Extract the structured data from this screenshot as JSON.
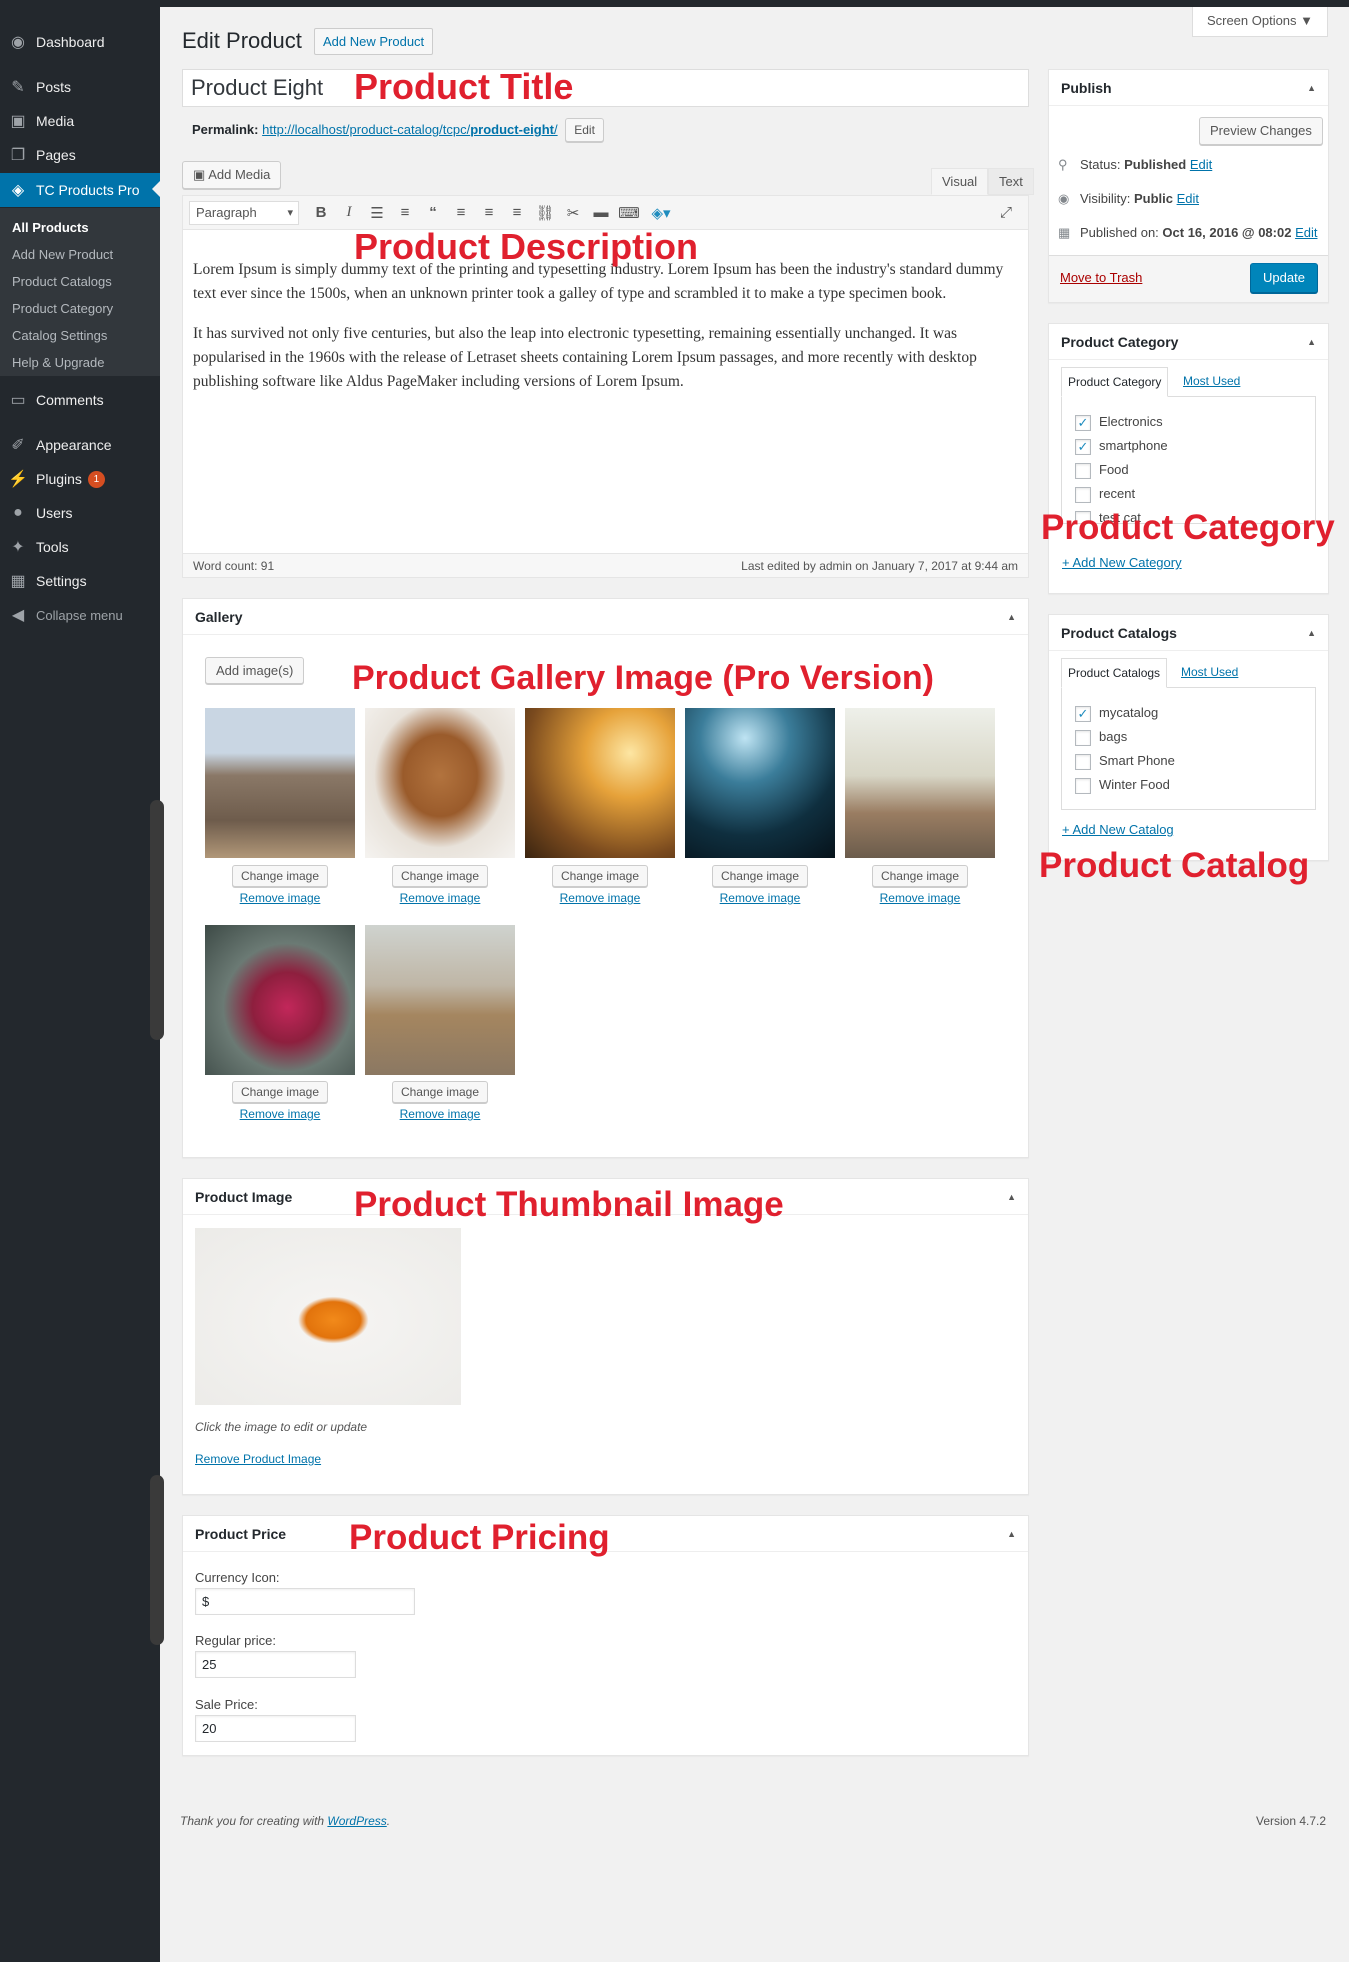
{
  "sidebar": {
    "menu": [
      {
        "label": "Dashboard",
        "icon": "dashboard-icon"
      },
      {
        "label": "Posts",
        "icon": "pin-icon"
      },
      {
        "label": "Media",
        "icon": "media-icon"
      },
      {
        "label": "Pages",
        "icon": "pages-icon"
      },
      {
        "label": "TC Products Pro",
        "icon": "dropbox-icon"
      },
      {
        "label": "Comments",
        "icon": "comment-icon"
      },
      {
        "label": "Appearance",
        "icon": "brush-icon"
      },
      {
        "label": "Plugins",
        "icon": "plugin-icon",
        "badge": "1"
      },
      {
        "label": "Users",
        "icon": "users-icon"
      },
      {
        "label": "Tools",
        "icon": "wrench-icon"
      },
      {
        "label": "Settings",
        "icon": "settings-icon"
      },
      {
        "label": "Collapse menu",
        "icon": "collapse-icon"
      }
    ],
    "submenu": [
      "All Products",
      "Add New Product",
      "Product Catalogs",
      "Product Category",
      "Catalog Settings",
      "Help & Upgrade"
    ]
  },
  "header": {
    "title": "Edit Product",
    "add_new": "Add New Product",
    "screen_options": "Screen Options"
  },
  "post": {
    "title": "Product Eight",
    "permalink_label": "Permalink:",
    "permalink_base": "http://localhost/product-catalog/tcpc/",
    "permalink_slug": "product-eight",
    "permalink_trail": "/",
    "permalink_edit": "Edit"
  },
  "editor": {
    "add_media": "Add Media",
    "tab_visual": "Visual",
    "tab_text": "Text",
    "format": "Paragraph",
    "para1": "Lorem Ipsum is simply dummy text of the printing and typesetting industry. Lorem Ipsum has been the industry's standard dummy text ever since the 1500s, when an unknown printer took a galley of type and scrambled it to make a type specimen book.",
    "para2": "It has survived not only five centuries, but also the leap into electronic typesetting, remaining essentially unchanged. It was popularised in the 1960s with the release of Letraset sheets containing Lorem Ipsum passages, and more recently with desktop publishing software like Aldus PageMaker including versions of Lorem Ipsum.",
    "word_count": "Word count: 91",
    "last_edited": "Last edited by admin on January 7, 2017 at 9:44 am"
  },
  "gallery": {
    "title": "Gallery",
    "add_images": "Add image(s)",
    "change": "Change image",
    "remove": "Remove image",
    "images": [
      "elephants",
      "pecans",
      "sunset-woman",
      "concert",
      "dancer",
      "apple",
      "guitar-girl"
    ]
  },
  "product_image": {
    "title": "Product Image",
    "hint": "Click the image to edit or update",
    "remove": "Remove Product Image"
  },
  "price": {
    "title": "Product Price",
    "currency_label": "Currency Icon:",
    "currency": "$",
    "regular_label": "Regular price:",
    "regular": "25",
    "sale_label": "Sale Price:",
    "sale": "20"
  },
  "publish": {
    "title": "Publish",
    "preview": "Preview Changes",
    "status_label": "Status:",
    "status": "Published",
    "visibility_label": "Visibility:",
    "visibility": "Public",
    "published_label": "Published on:",
    "published": "Oct 16, 2016 @ 08:02",
    "edit": "Edit",
    "trash": "Move to Trash",
    "update": "Update"
  },
  "category": {
    "title": "Product Category",
    "tab_all": "Product Category",
    "tab_used": "Most Used",
    "items": [
      {
        "label": "Electronics",
        "checked": true
      },
      {
        "label": "smartphone",
        "checked": true
      },
      {
        "label": "Food",
        "checked": false
      },
      {
        "label": "recent",
        "checked": false
      },
      {
        "label": "test cat",
        "checked": false
      }
    ],
    "add_new": "+ Add New Category"
  },
  "catalogs": {
    "title": "Product Catalogs",
    "tab_all": "Product Catalogs",
    "tab_used": "Most Used",
    "items": [
      {
        "label": "mycatalog",
        "checked": true
      },
      {
        "label": "bags",
        "checked": false
      },
      {
        "label": "Smart Phone",
        "checked": false
      },
      {
        "label": "Winter Food",
        "checked": false
      }
    ],
    "add_new": "+ Add New Catalog"
  },
  "annotations": {
    "title": "Product Title",
    "description": "Product  Description",
    "gallery": "Product Gallery Image (Pro Version)",
    "category": "Product Category",
    "catalog": "Product Catalog",
    "thumbnail": "Product Thumbnail Image",
    "pricing": "Product Pricing"
  },
  "footer": {
    "thanks_pre": "Thank you for creating with ",
    "thanks_link": "WordPress",
    "thanks_post": ".",
    "version": "Version 4.7.2"
  },
  "colors": {
    "accent": "#0073aa",
    "sidebar": "#23282d",
    "annotation": "#e0202e",
    "update_button": "#0085ba"
  }
}
